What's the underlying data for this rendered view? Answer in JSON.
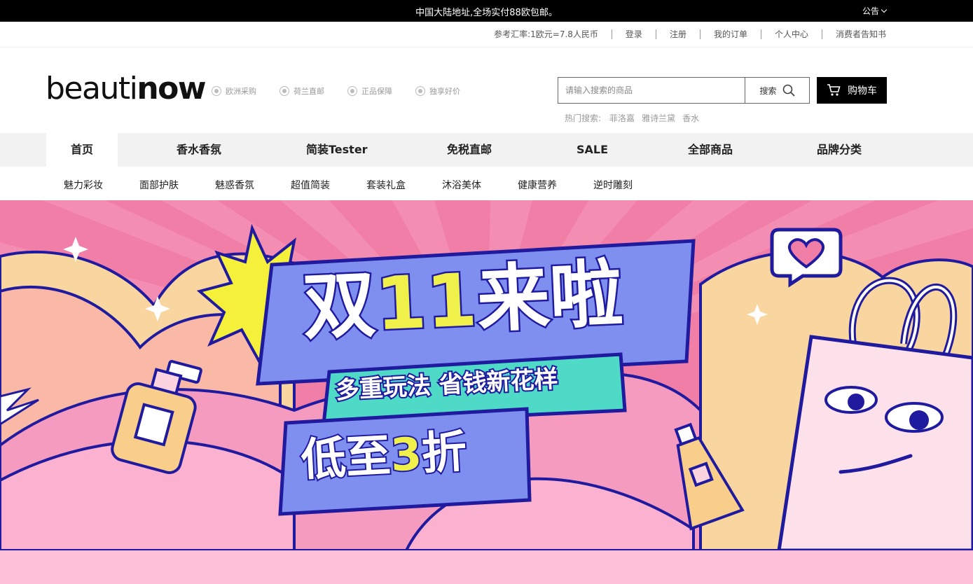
{
  "announcement": {
    "message": "中国大陆地址,全场实付88欧包邮。",
    "notice_label": "公告"
  },
  "utility": {
    "exchange_rate": "参考汇率:1欧元=7.8人民币",
    "login": "登录",
    "register": "注册",
    "my_orders": "我的订单",
    "personal_center": "个人中心",
    "consumer_notice": "消费者告知书"
  },
  "header": {
    "logo": {
      "part1": "beauti",
      "part2": "now"
    },
    "features": [
      "欧洲采购",
      "荷兰直邮",
      "正品保障",
      "独享好价"
    ],
    "search": {
      "placeholder": "请输入搜索的商品",
      "button_label": "搜索"
    },
    "cart_label": "购物车",
    "hot_search": {
      "label": "热门搜索:",
      "terms": [
        "菲洛嘉",
        "雅诗兰黛",
        "香水"
      ]
    }
  },
  "main_nav": [
    "首页",
    "香水香氛",
    "简装Tester",
    "免税直邮",
    "SALE",
    "全部商品",
    "品牌分类"
  ],
  "sub_nav": [
    "魅力彩妆",
    "面部护肤",
    "魅惑香氛",
    "超值简装",
    "套装礼盒",
    "沐浴美体",
    "健康营养",
    "逆时雕刻"
  ],
  "banner": {
    "headline_a": "双",
    "headline_b": "11",
    "headline_c": "来啦",
    "subline": "多重玩法 省钱新花样",
    "discount_a": "低至",
    "discount_b": "3",
    "discount_c": "折"
  },
  "colors": {
    "banner_bg": "#f07ea6",
    "navy": "#1f1a9e",
    "periwinkle": "#7f8ff0",
    "teal": "#4fd9c7",
    "yellow": "#f0f04a",
    "peach": "#f9c9a6"
  }
}
